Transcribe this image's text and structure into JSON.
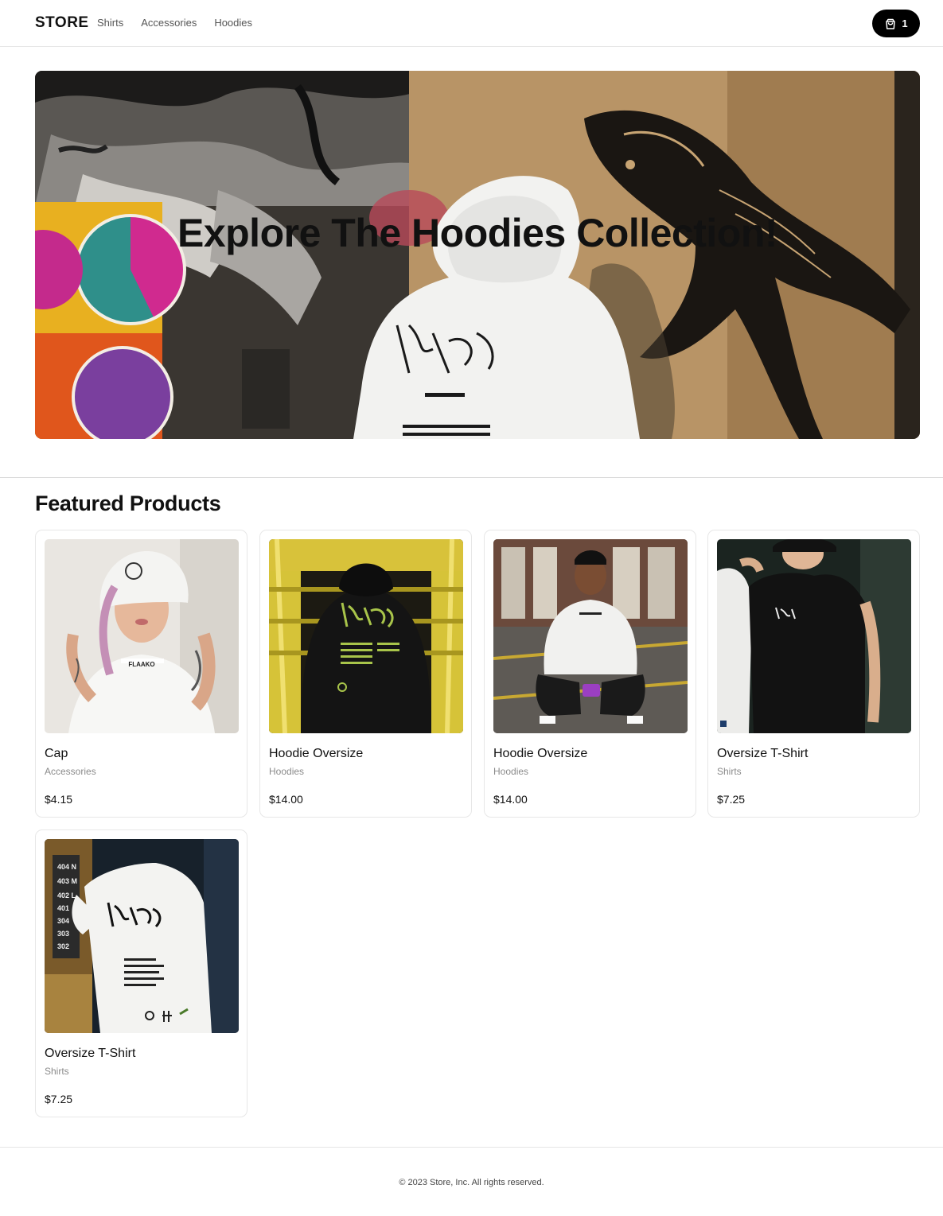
{
  "header": {
    "brand": "STORE",
    "nav": [
      "Shirts",
      "Accessories",
      "Hoodies"
    ],
    "cart_count": "1"
  },
  "hero": {
    "title": "Explore The Hoodies Collection!"
  },
  "featured": {
    "title": "Featured Products",
    "products": [
      {
        "name": "Cap",
        "category": "Accessories",
        "price": "$4.15"
      },
      {
        "name": "Hoodie Oversize",
        "category": "Hoodies",
        "price": "$14.00"
      },
      {
        "name": "Hoodie Oversize",
        "category": "Hoodies",
        "price": "$14.00"
      },
      {
        "name": "Oversize T-Shirt",
        "category": "Shirts",
        "price": "$7.25"
      },
      {
        "name": "Oversize T-Shirt",
        "category": "Shirts",
        "price": "$7.25"
      }
    ]
  },
  "footer": {
    "text": "© 2023 Store, Inc. All rights reserved."
  }
}
